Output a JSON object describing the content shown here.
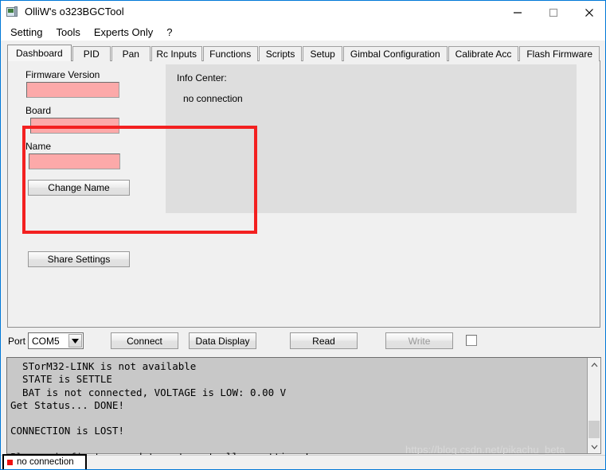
{
  "window": {
    "title": "OlliW's o323BGCTool",
    "icon": "app-tool-icon",
    "controls": {
      "minimize": "minimize-icon",
      "maximize": "maximize-icon",
      "close": "close-icon"
    }
  },
  "menu": {
    "items": [
      {
        "label": "Setting"
      },
      {
        "label": "Tools"
      },
      {
        "label": "Experts Only"
      },
      {
        "label": "?"
      }
    ]
  },
  "tabs": {
    "active_index": 0,
    "items": [
      {
        "label": "Dashboard"
      },
      {
        "label": "PID"
      },
      {
        "label": "Pan"
      },
      {
        "label": "Rc Inputs"
      },
      {
        "label": "Functions"
      },
      {
        "label": "Scripts"
      },
      {
        "label": "Setup"
      },
      {
        "label": "Gimbal Configuration"
      },
      {
        "label": "Calibrate Acc"
      },
      {
        "label": "Flash Firmware"
      }
    ]
  },
  "dashboard": {
    "fields": [
      {
        "label": "Firmware Version",
        "value": ""
      },
      {
        "label": "Board",
        "value": ""
      },
      {
        "label": "Name",
        "value": ""
      }
    ],
    "buttons": {
      "change_name": "Change Name",
      "share_settings": "Share Settings"
    },
    "info_center": {
      "label": "Info Center:",
      "value": "no connection"
    },
    "highlight_color": "#f32020",
    "field_fill_color": "#fca9a9"
  },
  "toolbar": {
    "port_label": "Port",
    "port_value": "COM5",
    "connect_label": "Connect",
    "data_display_label": "Data Display",
    "read_label": "Read",
    "write_label": "Write",
    "write_enabled": false,
    "checkbox_checked": false
  },
  "console": {
    "text": "  STorM32-LINK is not available\n  STATE is SETTLE\n  BAT is not connected, VOLTAGE is LOW: 0.00 V\nGet Status... DONE!\n\nCONNECTION is LOST!\n\nPlease do first a read to get controller settings!"
  },
  "statusbar": {
    "indicator_color": "#ef1111",
    "text": "no connection"
  },
  "watermark": {
    "text": "https://blog.csdn.net/pikachu_beta"
  }
}
